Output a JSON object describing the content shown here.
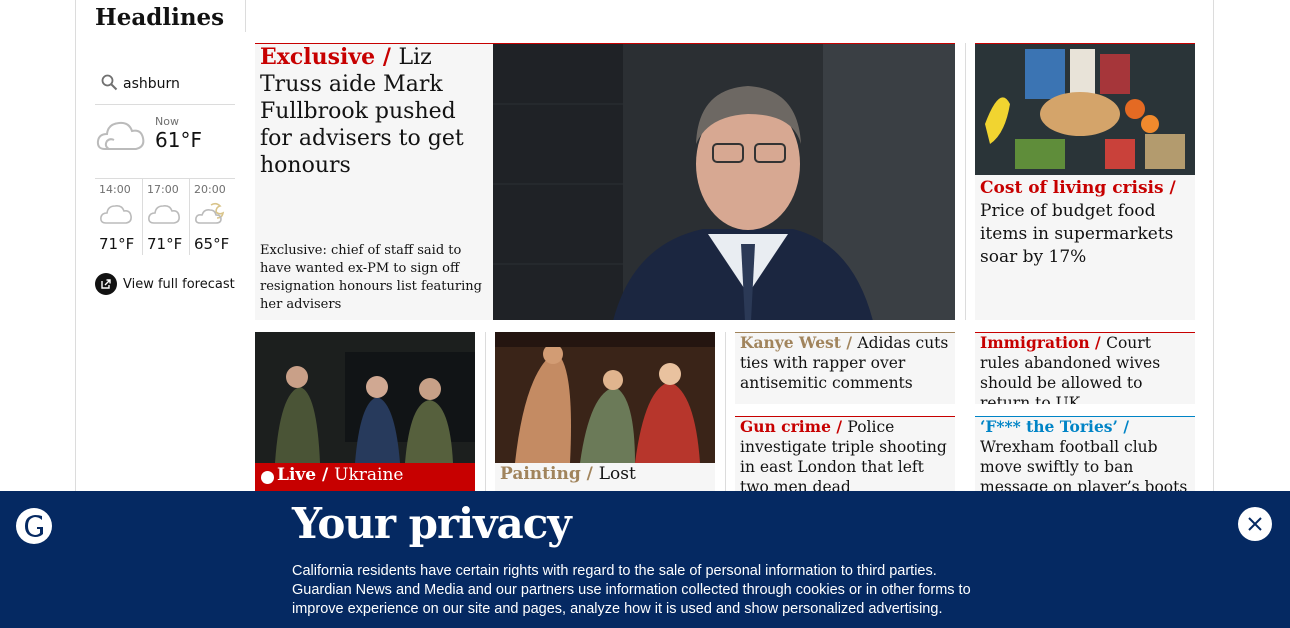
{
  "section": {
    "title": "Headlines"
  },
  "weather": {
    "location": "ashburn",
    "now_label": "Now",
    "now_temp": "61°F",
    "forecast": [
      {
        "time": "14:00",
        "temp": "71°F",
        "icon": "cloud-icon"
      },
      {
        "time": "17:00",
        "temp": "71°F",
        "icon": "cloud-icon"
      },
      {
        "time": "20:00",
        "temp": "65°F",
        "icon": "partly-cloudy-night-icon"
      }
    ],
    "full_forecast_label": "View full forecast"
  },
  "cards": {
    "lead": {
      "kicker": "Exclusive / ",
      "headline": "Liz Truss aide Mark Fullbrook pushed for advisers to get honours",
      "standfirst": "Exclusive: chief of staff said to have wanted ex-PM to sign off resignation honours list featuring her advisers"
    },
    "cost_of_living": {
      "kicker": "Cost of living crisis / ",
      "headline": "Price of budget food items in supermarkets soar by 17%"
    },
    "ukraine": {
      "kicker": "Live / ",
      "headline": "Ukraine"
    },
    "painting": {
      "kicker": "Painting / ",
      "headline": "Lost"
    },
    "kanye": {
      "kicker": "Kanye West / ",
      "headline": "Adidas cuts ties with rapper over antisemitic comments"
    },
    "gun_crime": {
      "kicker": "Gun crime / ",
      "headline": "Police investigate triple shooting in east London that left two men dead"
    },
    "immigration": {
      "kicker": "Immigration  / ",
      "headline": "Court rules abandoned wives should be allowed to return to UK"
    },
    "wrexham": {
      "kicker": "‘F*** the Tories’ / ",
      "headline": "Wrexham football club move swiftly to ban message on player’s boots"
    }
  },
  "privacy": {
    "title": "Your privacy",
    "body": "California residents have certain rights with regard to the sale of personal information to third parties. Guardian News and Media and our partners use information collected through cookies or in other forms to improve experience on our site and pages, analyze how it is used and show personalized advertising."
  },
  "colors": {
    "news_red": "#c70000",
    "culture_gold": "#a1845c",
    "opinion_blue": "#0084c6",
    "brand_navy": "#052962"
  }
}
